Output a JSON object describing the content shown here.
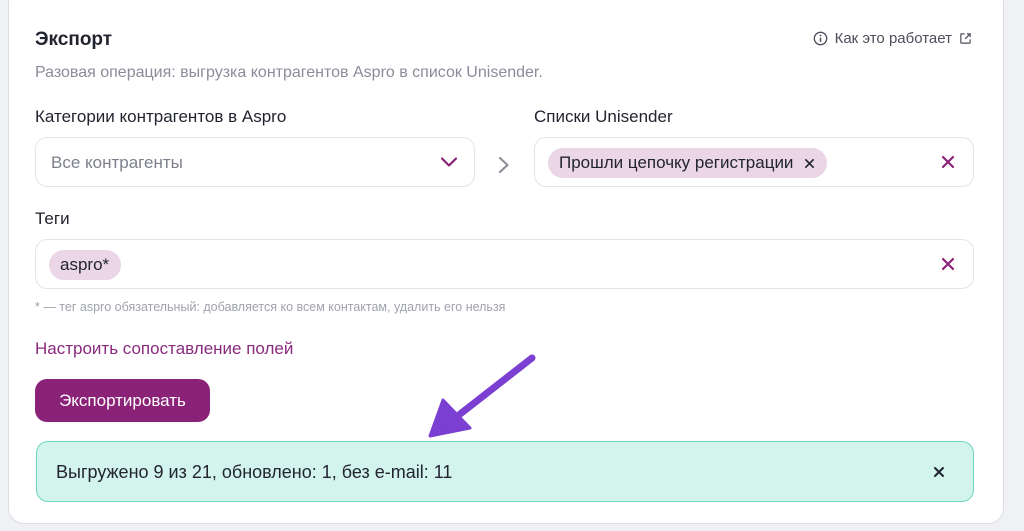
{
  "export": {
    "title": "Экспорт",
    "how_it_works": "Как это работает",
    "subtitle": "Разовая операция: выгрузка контрагентов Aspro в список Unisender."
  },
  "categories": {
    "label": "Категории контрагентов в Aspro",
    "selected": "Все контрагенты"
  },
  "lists": {
    "label": "Списки Unisender",
    "chips": [
      "Прошли цепочку регистрации"
    ]
  },
  "tags": {
    "label": "Теги",
    "chips": [
      "aspro*"
    ],
    "hint": "* — тег aspro обязательный: добавляется ко всем контактам, удалить его нельзя"
  },
  "mapping_link": "Настроить сопоставление полей",
  "export_button": "Экспортировать",
  "result": {
    "message": "Выгружено 9 из 21, обновлено: 1, без e-mail: 11"
  },
  "colors": {
    "accent": "#8a2278",
    "chip_bg": "#ead6e6",
    "success_bg": "#d3f4ec",
    "success_border": "#6fd7c1",
    "annotation_arrow": "#7b3fd1"
  },
  "icons": {
    "info": "info-circle-icon",
    "external": "external-link-icon",
    "dropdown": "chevron-down-icon",
    "transfer": "chevron-right-icon",
    "remove": "close-icon"
  }
}
